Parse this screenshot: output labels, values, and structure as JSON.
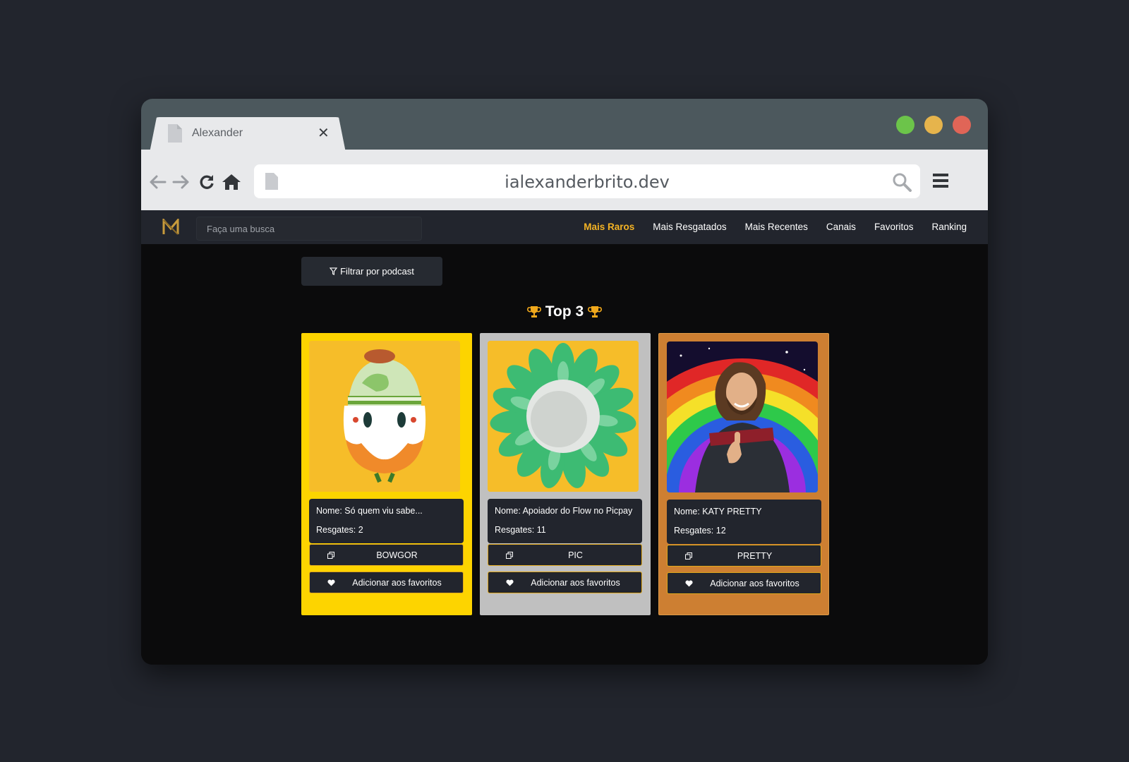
{
  "browser": {
    "tab_title": "Alexander",
    "url": "ialexanderbrito.dev"
  },
  "navbar": {
    "search_placeholder": "Faça uma busca",
    "links": [
      "Mais Raros",
      "Mais Resgatados",
      "Mais Recentes",
      "Canais",
      "Favoritos",
      "Ranking"
    ],
    "active_link": "Mais Raros"
  },
  "filter": {
    "label": "Filtrar por podcast"
  },
  "heading": {
    "text": "Top 3"
  },
  "cards": [
    {
      "rank_color": "#fdd400",
      "name": "Nome: Só quem viu sabe...",
      "redemptions": "Resgates: 2",
      "code": "BOWGOR",
      "fav_label": "Adicionar aos favoritos",
      "image": "clown-car-pixel-art"
    },
    {
      "rank_color": "#c0c0c0",
      "name": "Nome: Apoiador do Flow no Picpay",
      "redemptions": "Resgates: 11",
      "code": "PIC",
      "fav_label": "Adicionar aos favoritos",
      "image": "green-flower"
    },
    {
      "rank_color": "#cd7f32",
      "name": "Nome: KATY PRETTY",
      "redemptions": "Resgates: 12",
      "code": "PRETTY",
      "fav_label": "Adicionar aos favoritos",
      "image": "man-rainbow-thumbs-up"
    }
  ],
  "colors": {
    "accent": "#f4b324",
    "background": "#0b0b0c",
    "navbar": "#22252d"
  }
}
